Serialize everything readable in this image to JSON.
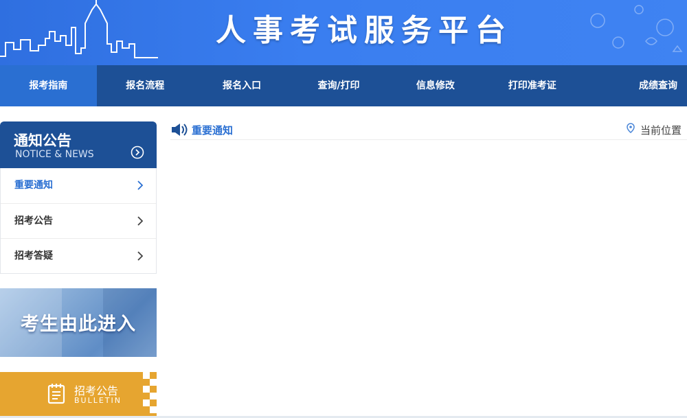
{
  "header": {
    "title": "人事考试服务平台"
  },
  "nav": {
    "items": [
      {
        "label": "报考指南",
        "active": true
      },
      {
        "label": "报名流程"
      },
      {
        "label": "报名入口"
      },
      {
        "label": "查询/打印"
      },
      {
        "label": "信息修改"
      },
      {
        "label": "打印准考证"
      },
      {
        "label": "成绩查询"
      }
    ]
  },
  "sidebar": {
    "title": "通知公告",
    "subtitle": "NOTICE & NEWS",
    "items": [
      {
        "label": "重要通知",
        "active": true
      },
      {
        "label": "招考公告"
      },
      {
        "label": "招考答疑"
      }
    ]
  },
  "promos": {
    "entry": "考生由此进入",
    "bulletin": "招考公告",
    "bulletin_en": "BULLETIN"
  },
  "content": {
    "section_title": "重要通知",
    "location_label": "当前位置"
  },
  "colors": {
    "nav_bg": "#1d5096",
    "nav_active": "#2a6fd2",
    "banner_blue": "#3a7ef0",
    "accent_blue": "#2a6fd2",
    "bulletin_orange": "#e6a530"
  }
}
